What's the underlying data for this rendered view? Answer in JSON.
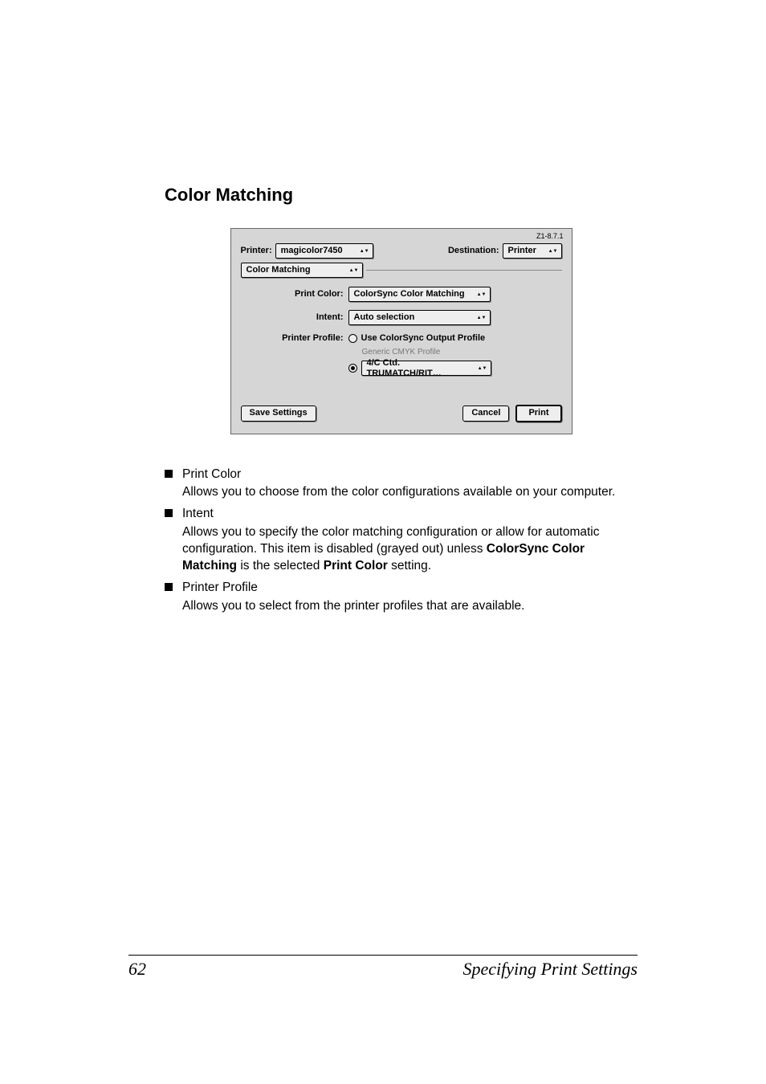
{
  "section_title": "Color Matching",
  "dialog": {
    "version": "Z1-8.7.1",
    "printer_label": "Printer:",
    "printer_value": "magicolor7450",
    "destination_label": "Destination:",
    "destination_value": "Printer",
    "panel_name": "Color Matching",
    "print_color_label": "Print Color:",
    "print_color_value": "ColorSync Color Matching",
    "intent_label": "Intent:",
    "intent_value": "Auto selection",
    "printer_profile_label": "Printer Profile:",
    "printer_profile_option1": "Use ColorSync Output Profile",
    "printer_profile_option1_sub": "Generic CMYK Profile",
    "printer_profile_option2_value": "4/C Ctd. TRUMATCH/RIT…",
    "save_settings": "Save Settings",
    "cancel": "Cancel",
    "print": "Print"
  },
  "items": [
    {
      "head": "Print Color",
      "body_plain": "Allows you to choose from the color configurations available on your computer."
    },
    {
      "head": "Intent",
      "body_pre": "Allows you to specify the color matching configuration or allow for automatic configuration. This item is disabled (grayed out) unless ",
      "body_b1": "ColorSync Color Matching",
      "body_mid": " is the selected ",
      "body_b2": "Print Color",
      "body_post": " setting."
    },
    {
      "head": "Printer Profile",
      "body_plain": "Allows you to select from the printer profiles that are available."
    }
  ],
  "footer": {
    "page": "62",
    "title": "Specifying Print Settings"
  }
}
